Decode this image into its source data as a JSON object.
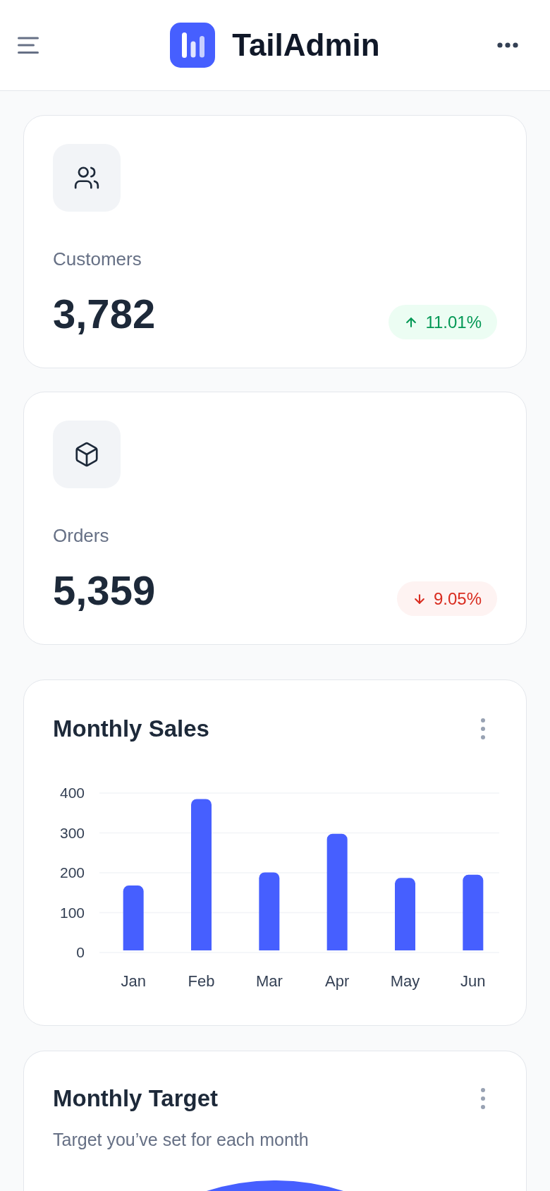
{
  "header": {
    "title": "TailAdmin"
  },
  "stats": [
    {
      "label": "Customers",
      "value": "3,782",
      "increase": true,
      "change": "11.01%"
    },
    {
      "label": "Orders",
      "value": "5,359",
      "increase": false,
      "change": "9.05%"
    }
  ],
  "monthly_sales": {
    "title": "Monthly Sales",
    "chart_data": {
      "type": "bar",
      "categories": [
        "Jan",
        "Feb",
        "Mar",
        "Apr",
        "May",
        "Jun"
      ],
      "values": [
        168,
        385,
        201,
        298,
        187,
        195
      ],
      "ylim": [
        0,
        400
      ],
      "yticks": [
        0,
        100,
        200,
        300,
        400
      ],
      "grid": true
    }
  },
  "monthly_target": {
    "title": "Monthly Target",
    "subtitle": "Target you’ve set for each month"
  }
}
